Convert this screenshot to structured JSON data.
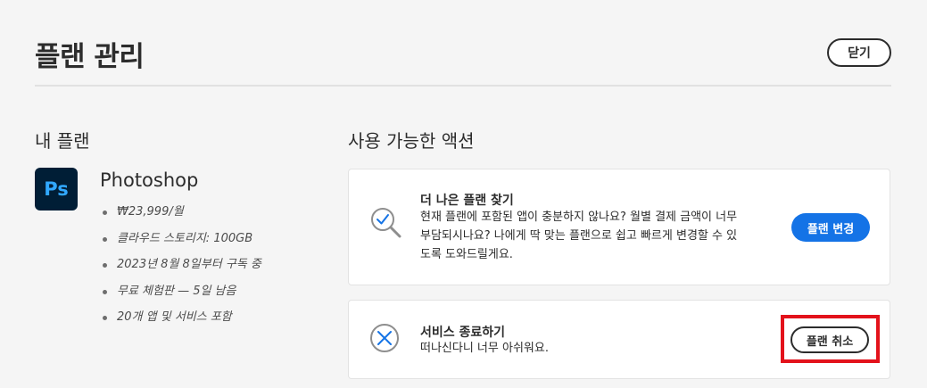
{
  "header": {
    "title": "플랜 관리",
    "close_label": "닫기"
  },
  "my_plan": {
    "section_title": "내 플랜",
    "app_icon_text": "Ps",
    "app_icon_name": "photoshop-icon",
    "product_name": "Photoshop",
    "details": [
      "₩23,999/월",
      "클라우드 스토리지: 100GB",
      "2023년 8월 8일부터 구독 중",
      "무료 체험판 — 5일 남음",
      "20개 앱 및 서비스 포함"
    ]
  },
  "actions": {
    "section_title": "사용 가능한 액션",
    "cards": [
      {
        "icon": "magnifier-check-icon",
        "title": "더 나은 플랜 찾기",
        "description_lines": [
          "현재 플랜에 포함된 앱이 충분하지 않나요? 월별 결제 금액이 너무",
          "부담되시나요? 나에게 딱 맞는 플랜으로 쉽고 빠르게 변경할 수 있",
          "도록 도와드릴게요."
        ],
        "button_label": "플랜 변경"
      },
      {
        "icon": "circle-x-icon",
        "title": "서비스 종료하기",
        "description_lines": [
          "떠나신다니 너무 아쉬워요."
        ],
        "button_label": "플랜 취소"
      }
    ]
  },
  "colors": {
    "background": "#f5f5f5",
    "accent_blue": "#1473e6",
    "icon_blue": "#1473e6",
    "photoshop_bg": "#001e36",
    "photoshop_text": "#31a8ff",
    "highlight_red": "#e3121b"
  }
}
